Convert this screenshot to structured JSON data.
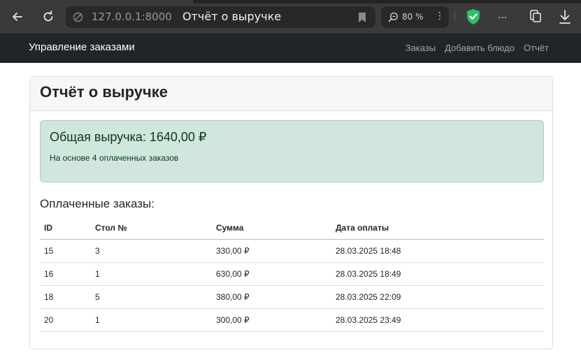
{
  "browser": {
    "url": "127.0.0.1:8000",
    "tab_title": "Отчёт о выручке",
    "zoom": "80 %",
    "menu_dots": "⋮",
    "extensions_overflow": "...",
    "accent": "#3a3a3d",
    "shield_color": "#2fbe6b"
  },
  "navbar": {
    "brand": "Управление заказами",
    "links": [
      "Заказы",
      "Добавить блюдо",
      "Отчёт"
    ]
  },
  "card": {
    "title": "Отчёт о выручке",
    "alert": {
      "title": "Общая выручка: 1640,00 ₽",
      "subtitle": "На основе 4 оплаченных заказов",
      "bg_color": "#d1e7dd"
    },
    "section_title": "Оплаченные заказы:",
    "table": {
      "headers": [
        "ID",
        "Стол №",
        "Сумма",
        "Дата оплаты"
      ],
      "rows": [
        [
          "15",
          "3",
          "330,00 ₽",
          "28.03.2025 18:48"
        ],
        [
          "16",
          "1",
          "630,00 ₽",
          "28.03.2025 18:49"
        ],
        [
          "18",
          "5",
          "380,00 ₽",
          "28.03.2025 22:09"
        ],
        [
          "20",
          "1",
          "300,00 ₽",
          "28.03.2025 23:49"
        ]
      ]
    }
  }
}
